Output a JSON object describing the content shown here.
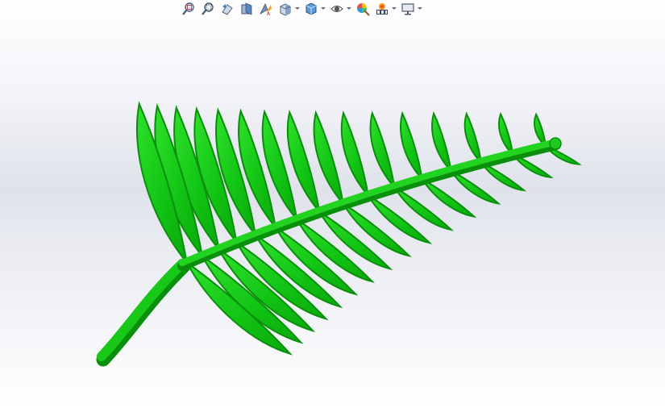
{
  "viewport": {
    "background_top": "#ffffff",
    "background_mid": "#dfe2ea",
    "background_bottom": "#ffffff"
  },
  "toolbar": {
    "tools": [
      {
        "icon": "zoom-to-fit-icon"
      },
      {
        "icon": "zoom-to-area-icon"
      },
      {
        "icon": "previous-view-icon"
      },
      {
        "icon": "section-view-icon"
      },
      {
        "icon": "dynamic-annotation-views-icon"
      },
      {
        "icon": "view-orientation-icon",
        "dropdown": true
      },
      {
        "icon": "display-style-icon",
        "dropdown": true
      },
      {
        "icon": "hide-show-items-icon",
        "dropdown": true
      },
      {
        "icon": "edit-appearance-icon"
      },
      {
        "icon": "apply-scene-icon",
        "dropdown": true
      },
      {
        "icon": "view-settings-icon",
        "dropdown": true
      }
    ]
  },
  "model": {
    "name": "fern-leaf-model",
    "color": "#12c414",
    "shade_color": "#0a8f0c",
    "highlight_color": "#2fe02c"
  }
}
